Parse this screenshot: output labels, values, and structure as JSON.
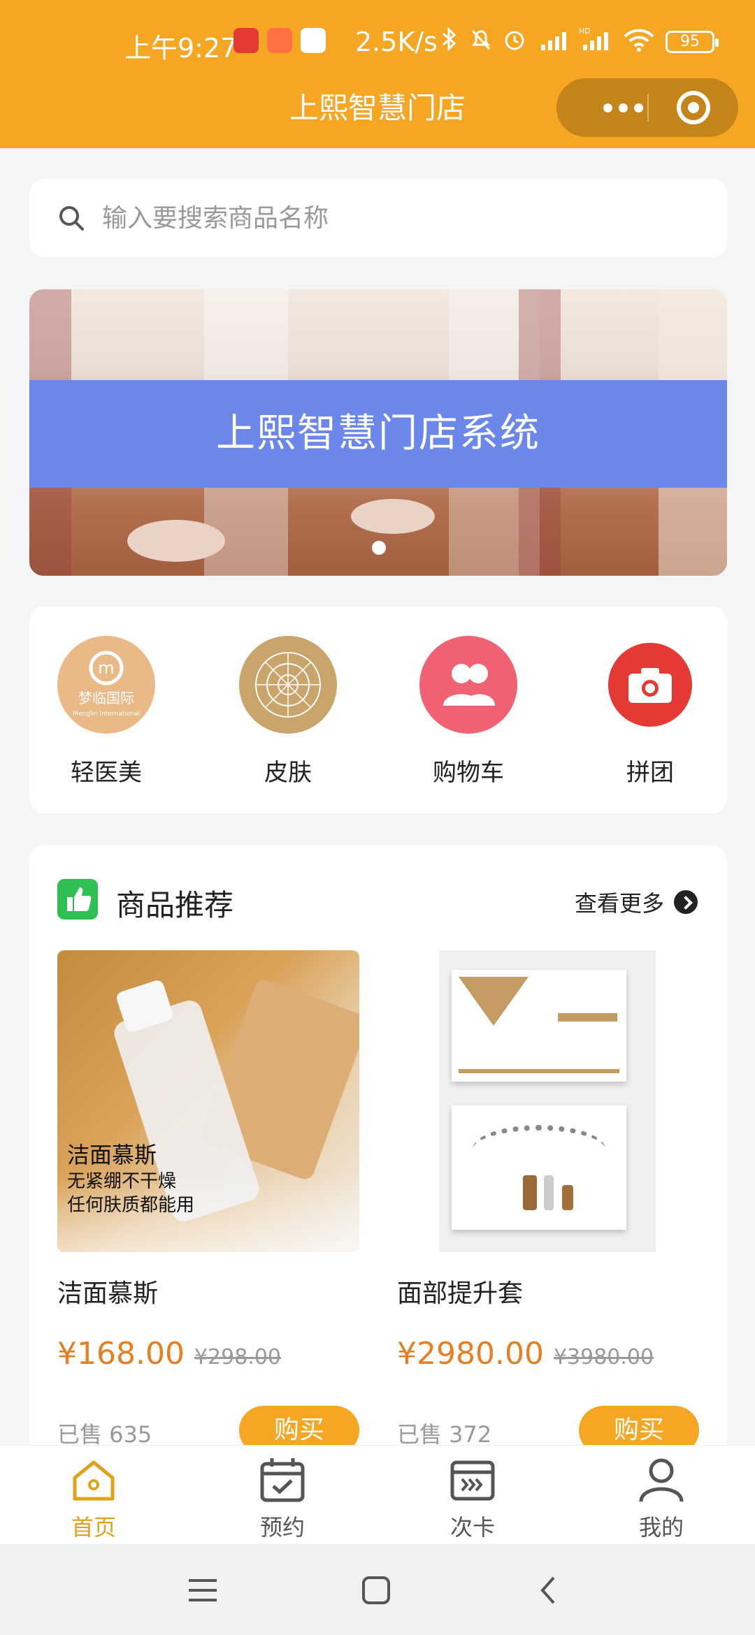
{
  "status_bar": {
    "time": "上午9:27",
    "net_speed": "2.5K/s",
    "signal": "HD",
    "battery": "95"
  },
  "title_bar": {
    "title": "上熙智慧门店"
  },
  "search": {
    "placeholder": "输入要搜索商品名称"
  },
  "banner": {
    "text": "上熙智慧门店系统"
  },
  "categories": [
    {
      "label": "轻医美",
      "logo_text": "梦临国际",
      "logo_sub": "Menglin International"
    },
    {
      "label": "皮肤"
    },
    {
      "label": "购物车"
    },
    {
      "label": "拼团"
    }
  ],
  "recommend": {
    "title": "商品推荐",
    "more": "查看更多",
    "products": [
      {
        "name": "洁面慕斯",
        "price": "¥168.00",
        "old_price": "¥298.00",
        "sold": "已售 635",
        "buy": "购买",
        "img_caption_1": "洁面慕斯",
        "img_caption_2": "无紧绷不干燥",
        "img_caption_3": "任何肤质都能用"
      },
      {
        "name": "面部提升套",
        "price": "¥2980.00",
        "old_price": "¥3980.00",
        "sold": "已售 372",
        "buy": "购买"
      }
    ]
  },
  "tabs": [
    {
      "label": "首页",
      "active": true
    },
    {
      "label": "预约"
    },
    {
      "label": "次卡"
    },
    {
      "label": "我的"
    }
  ],
  "colors": {
    "brand": "#f5a623",
    "price": "#e67e22",
    "banner_strip": "#6b87ea"
  }
}
